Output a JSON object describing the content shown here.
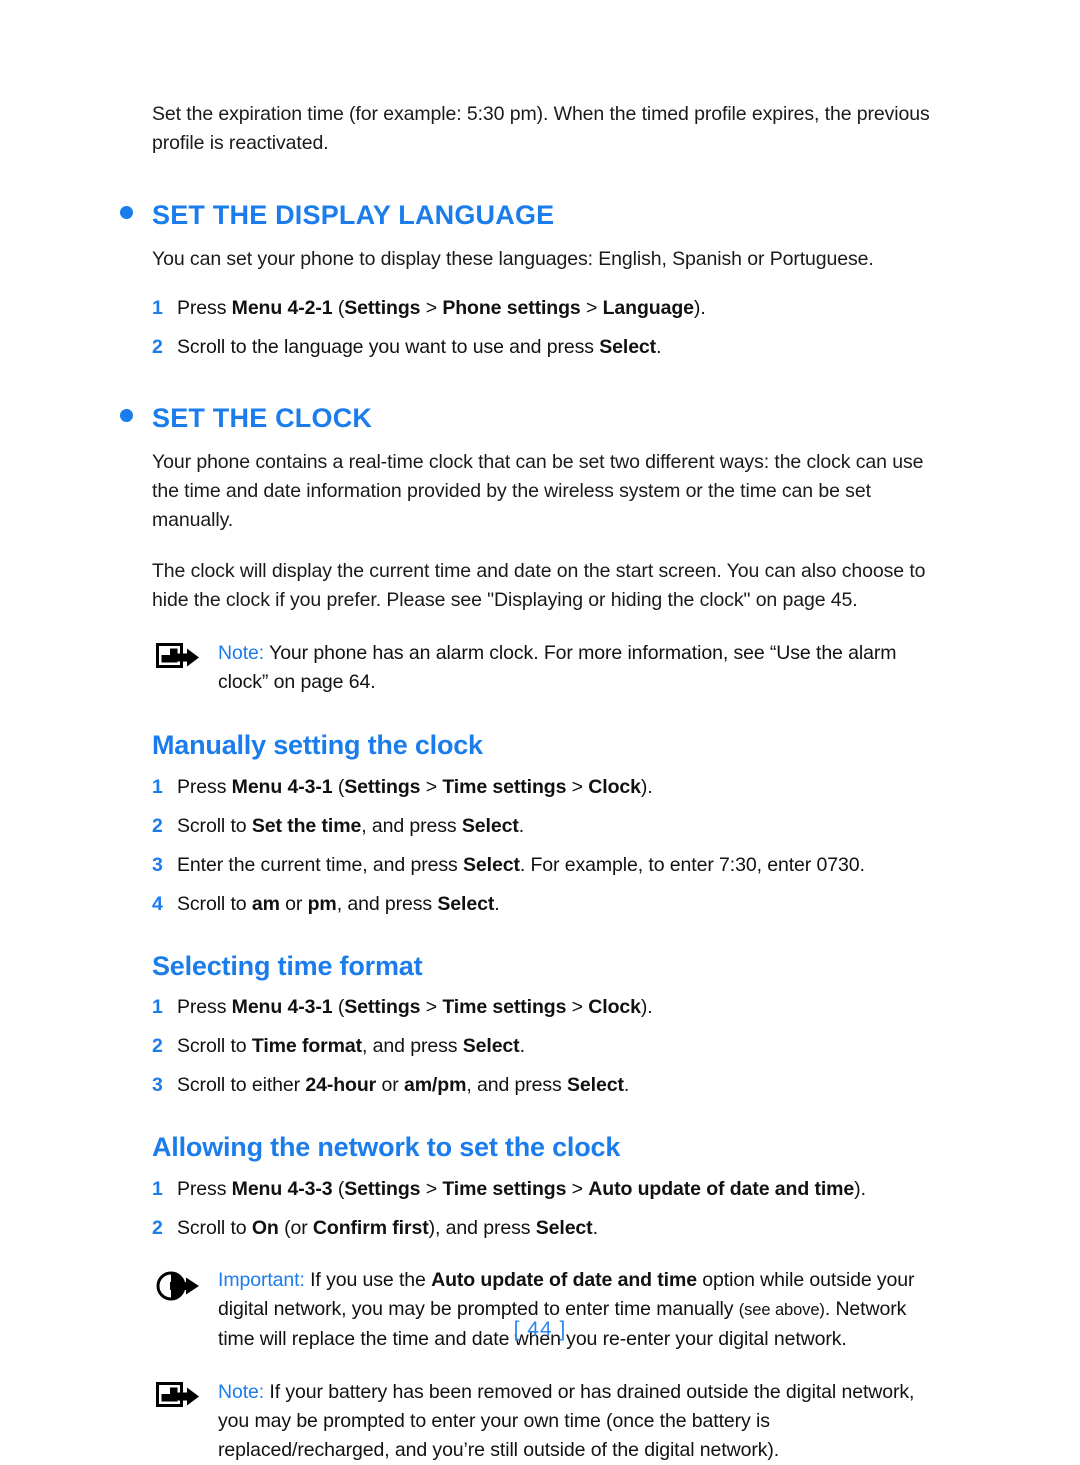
{
  "colors": {
    "heading_blue": "#1b7ceb",
    "body_black": "#1a1a1a",
    "page_number_blue": "#2f86ef"
  },
  "intro": {
    "paragraph": "Set the expiration time (for example: 5:30 pm). When the timed profile expires, the previous profile is reactivated."
  },
  "sections": [
    {
      "id": "set-the-display-language",
      "heading": "SET THE DISPLAY LANGUAGE",
      "intro": "You can set your phone to display these languages: English,  Spanish or Portuguese.",
      "steps": [
        {
          "num": "1",
          "html": "Press <b>Menu 4-2-1</b> (<b>Settings</b> > <b>Phone settings</b> > <b>Language</b>)."
        },
        {
          "num": "2",
          "html": "Scroll to the language you want to use and press <b>Select</b>."
        }
      ]
    },
    {
      "id": "set-the-clock",
      "heading": "SET THE CLOCK",
      "paragraphs": [
        "Your phone contains a real-time clock that can be set two different ways: the clock can use the time and date information provided by the wireless system or the time can be set manually.",
        "The clock will display the current time and date on the start screen. You can also choose to hide the clock if you prefer. Please see \"Displaying or hiding the clock\" on page 45."
      ]
    }
  ],
  "notices": {
    "note_alarm": {
      "icon": "note-icon",
      "label": "Note:",
      "html": " Your phone has an alarm clock. For more information, see “Use the alarm clock” on page 64."
    },
    "important_auto_update": {
      "icon": "important-icon",
      "label": "Important:",
      "html": " If you use the <b>Auto update of date and time</b> option while outside your digital network, you may be prompted to enter time manually <span class=\"small\">(see above)</span>. Network time will replace the time and date when you re-enter your digital network."
    },
    "note_battery": {
      "icon": "note-icon",
      "label": "Note:",
      "html": " If your battery has been removed or has drained outside the digital network, you may be prompted to enter your own time (once the battery is replaced/recharged, and you’re still outside of the digital network)."
    }
  },
  "subsections": [
    {
      "id": "manually-setting-the-clock",
      "heading": "Manually setting the clock",
      "steps": [
        {
          "num": "1",
          "html": "Press <b>Menu 4-3-1</b> (<b>Settings</b> > <b>Time settings</b> > <b>Clock</b>)."
        },
        {
          "num": "2",
          "html": "Scroll to <b>Set the time</b>, and press <b>Select</b>."
        },
        {
          "num": "3",
          "html": "Enter the current time, and press <b>Select</b>. For example, to enter 7:30, enter 0730."
        },
        {
          "num": "4",
          "html": "Scroll to <b>am</b> or <b>pm</b>, and press <b>Select</b>."
        }
      ]
    },
    {
      "id": "selecting-time-format",
      "heading": "Selecting time format",
      "steps": [
        {
          "num": "1",
          "html": "Press <b>Menu 4-3-1</b> (<b>Settings</b> > <b>Time settings</b> > <b>Clock</b>)."
        },
        {
          "num": "2",
          "html": "Scroll to <b>Time format</b>, and press <b>Select</b>."
        },
        {
          "num": "3",
          "html": "Scroll to either <b>24-hour</b> or <b>am/pm</b>, and press <b>Select</b>."
        }
      ]
    },
    {
      "id": "allowing-the-network-to-set-the-clock",
      "heading": "Allowing the network to set the clock",
      "steps": [
        {
          "num": "1",
          "html": "Press <b>Menu 4-3-3</b> (<b>Settings</b> > <b>Time settings</b> > <b>Auto update of date and time</b>)."
        },
        {
          "num": "2",
          "html": "Scroll to <b>On</b> (or <b>Confirm first</b>), and press <b>Select</b>."
        }
      ]
    }
  ],
  "footer": {
    "page_number": "[ 44 ]"
  }
}
